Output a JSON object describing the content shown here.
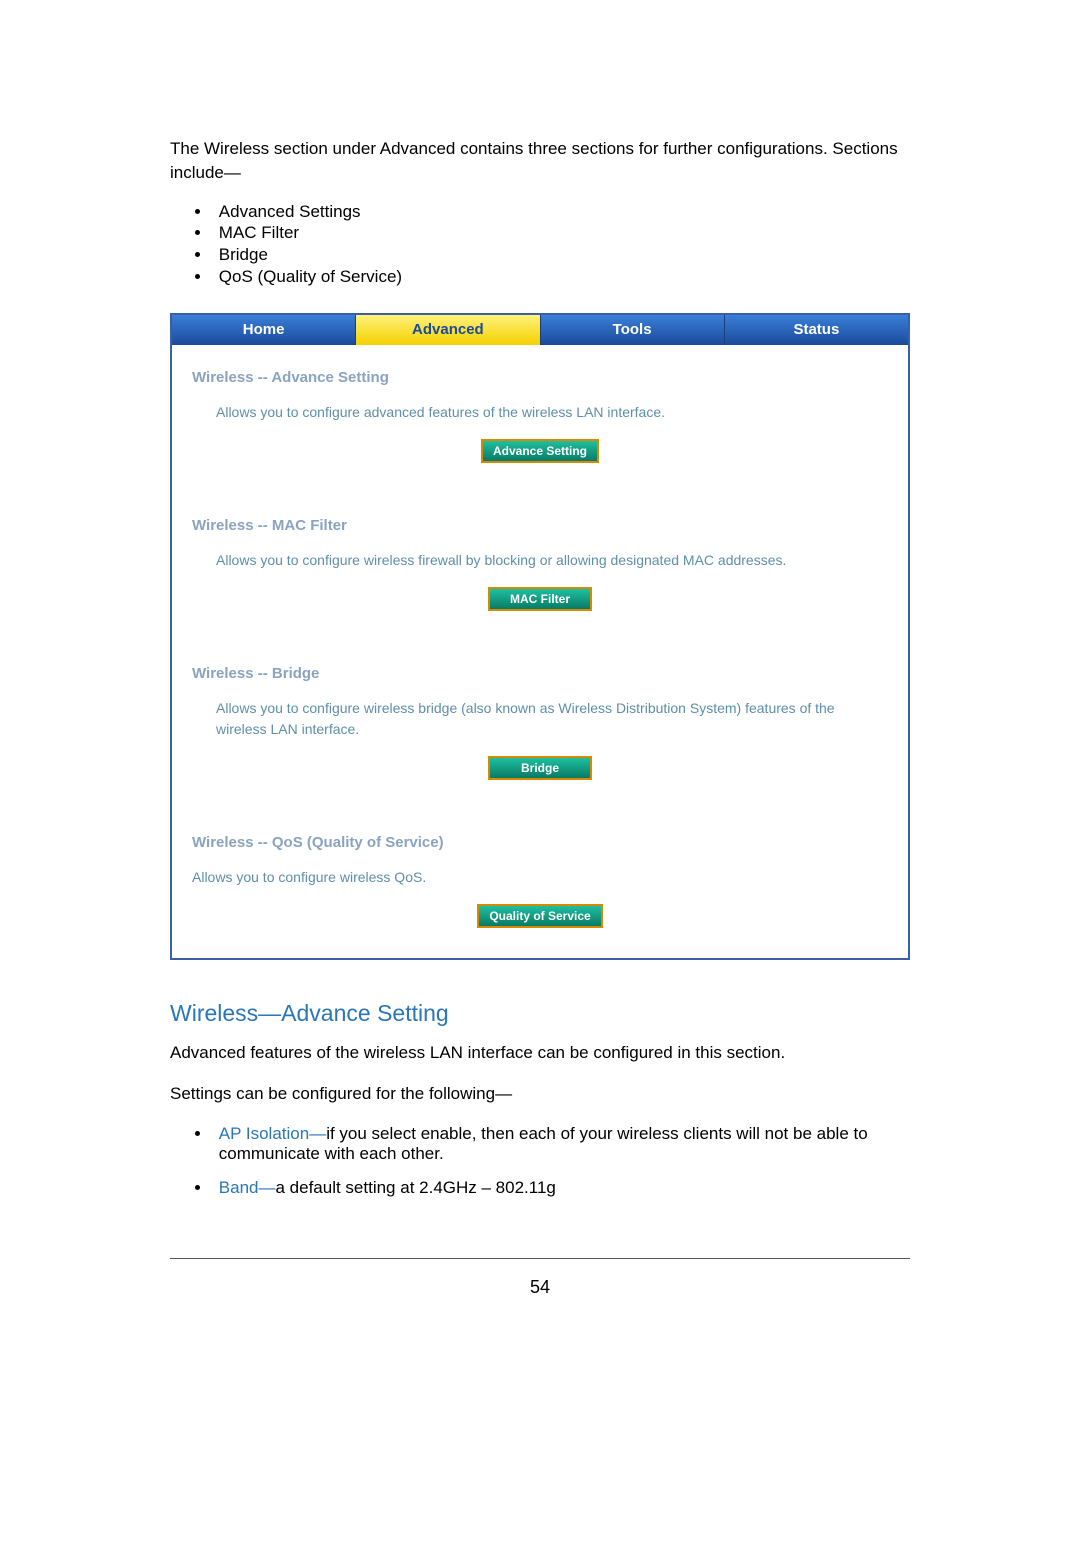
{
  "intro": "The Wireless section under Advanced contains three sections for further configurations.  Sections include—",
  "bullets": [
    "Advanced Settings",
    "MAC Filter",
    "Bridge",
    "QoS (Quality of Service)"
  ],
  "tabs": {
    "home": "Home",
    "advanced": "Advanced",
    "tools": "Tools",
    "status": "Status"
  },
  "sections": {
    "advance": {
      "title": "Wireless -- Advance Setting",
      "body": "Allows you to configure advanced features of the wireless LAN interface.",
      "button": "Advance Setting"
    },
    "mac": {
      "title": "Wireless -- MAC Filter",
      "body": "Allows you to configure wireless firewall by blocking or allowing designated MAC addresses.",
      "button": "MAC Filter"
    },
    "bridge": {
      "title": "Wireless -- Bridge",
      "body": "Allows you to configure wireless bridge (also known as Wireless Distribution System) features of the wireless LAN interface.",
      "button": "Bridge"
    },
    "qos": {
      "title": "Wireless -- QoS (Quality of Service)",
      "body": "Allows you to configure wireless QoS.",
      "button": "Quality of Service"
    }
  },
  "post": {
    "heading": "Wireless—Advance Setting",
    "p1": "Advanced features of the wireless LAN interface can be configured in this section.",
    "p2": "Settings can be configured for the following—",
    "ap_term": "AP Isolation—",
    "ap_text": "if you select enable, then each of your wireless clients will not be able to communicate with each other.",
    "band_term": "Band—",
    "band_text": "a default setting at 2.4GHz – 802.11g"
  },
  "page_number": "54"
}
